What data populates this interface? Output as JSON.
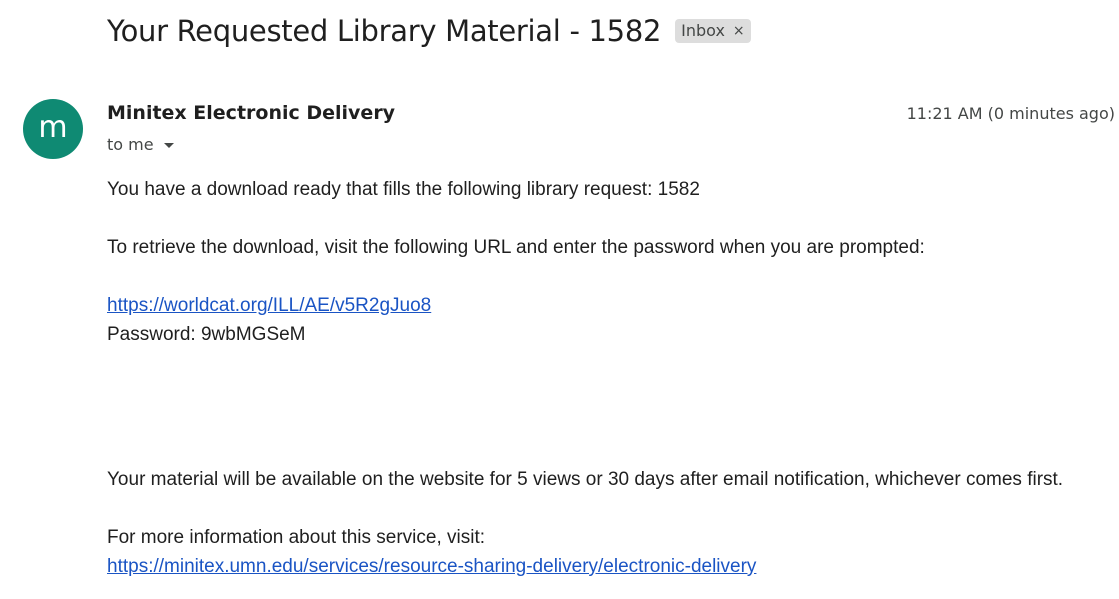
{
  "email": {
    "subject": "Your Requested Library Material - 1582",
    "label": "Inbox",
    "label_close": "×",
    "avatar_letter": "m",
    "avatar_color": "#0f8a73",
    "sender": "Minitex Electronic Delivery",
    "timestamp": "11:21 AM (0 minutes ago)",
    "recipient": "to me",
    "body": {
      "line1": "You have a download ready that fills the following library request: 1582",
      "line2": "To retrieve the download, visit the following URL and enter the password when you are prompted:",
      "download_link": "https://worldcat.org/ILL/AE/v5R2gJuo8",
      "password": "Password: 9wbMGSeM",
      "availability": "Your material will be available on the website for 5 views or 30 days after email notification, whichever comes first.",
      "more_info": "For more information about this service, visit:",
      "info_link": "https://minitex.umn.edu/services/resource-sharing-delivery/electronic-delivery"
    },
    "link_color": "#1a54c4"
  }
}
